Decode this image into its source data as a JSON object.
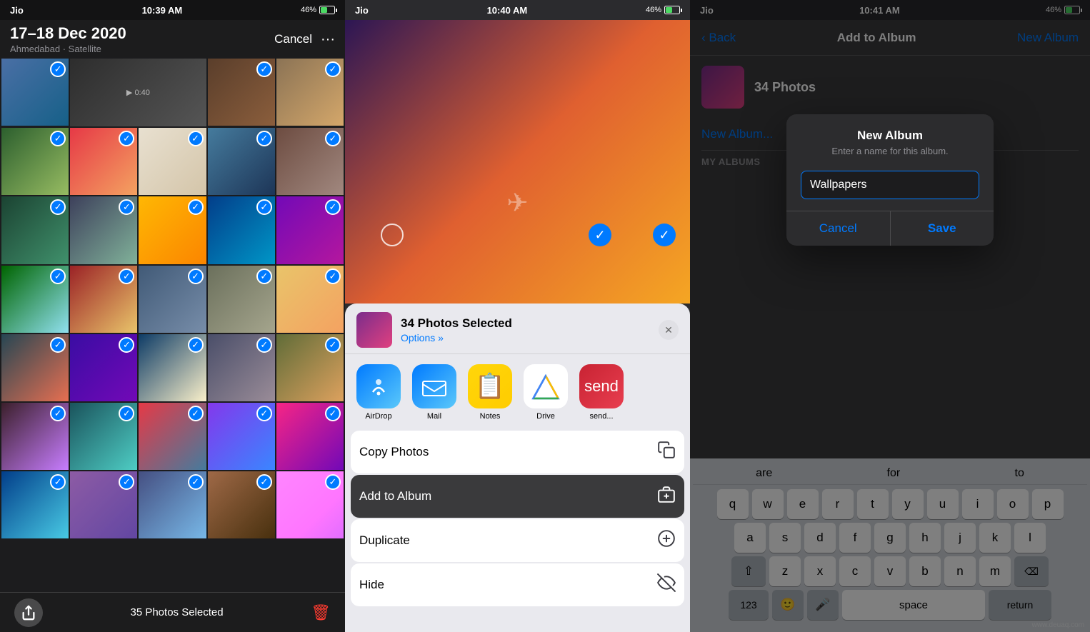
{
  "panel1": {
    "statusBar": {
      "carrier": "Jio",
      "time": "10:39 AM",
      "battery": "46%"
    },
    "header": {
      "title": "17–18 Dec 2020",
      "subtitle": "Ahmedabad · Satellite",
      "duration": "0:40",
      "cancelBtn": "Cancel",
      "moreBtn": "···"
    },
    "bottomBar": {
      "count": "35 Photos Selected"
    },
    "photoColors": [
      "c1",
      "c2",
      "c3",
      "c4",
      "c5",
      "c6",
      "c7",
      "c8",
      "c9",
      "c10",
      "c11",
      "c12",
      "c13",
      "c14",
      "c15",
      "c16",
      "c17",
      "c18",
      "c19",
      "c20",
      "c21",
      "c22",
      "c23",
      "c24",
      "c25",
      "c26",
      "c27",
      "c28",
      "c29",
      "c30"
    ]
  },
  "panel2": {
    "statusBar": {
      "carrier": "Jio",
      "time": "10:40 AM",
      "battery": "46%"
    },
    "shareSheet": {
      "title": "34 Photos Selected",
      "optionsLabel": "Options »",
      "apps": [
        {
          "name": "AirdropApp",
          "label": "AirDrop",
          "emoji": "📡"
        },
        {
          "name": "MailApp",
          "label": "Mail",
          "emoji": "✉️"
        },
        {
          "name": "NotesApp",
          "label": "Notes",
          "emoji": "📋"
        },
        {
          "name": "DriveApp",
          "label": "Drive",
          "emoji": "△"
        }
      ],
      "actions": [
        {
          "name": "CopyPhotos",
          "label": "Copy Photos",
          "icon": "⧉",
          "highlighted": false
        },
        {
          "name": "AddToAlbum",
          "label": "Add to Album",
          "icon": "🗂",
          "highlighted": true
        },
        {
          "name": "Duplicate",
          "label": "Duplicate",
          "icon": "⊕",
          "highlighted": false
        },
        {
          "name": "Hide",
          "label": "Hide",
          "icon": "👁",
          "highlighted": false
        }
      ]
    }
  },
  "panel3": {
    "statusBar": {
      "carrier": "Jio",
      "time": "10:41 AM",
      "battery": "46%"
    },
    "nav": {
      "backLabel": "‹ Back",
      "title": "Add to Album",
      "newAlbumLabel": "New Album"
    },
    "photoCount": "34 Photos",
    "newAlbumItem": "New Album...",
    "myAlbumsHeader": "My Albums",
    "dialog": {
      "title": "New Album",
      "subtitle": "Enter a name for this album.",
      "inputValue": "Wallpapers",
      "cancelBtn": "Cancel",
      "saveBtn": "Save"
    },
    "keyboard": {
      "suggestions": [
        "are",
        "for",
        "to"
      ],
      "row1": [
        "q",
        "w",
        "e",
        "r",
        "t",
        "y",
        "u",
        "i",
        "o",
        "p"
      ],
      "row2": [
        "a",
        "s",
        "d",
        "f",
        "g",
        "h",
        "j",
        "k",
        "l"
      ],
      "row3": [
        "z",
        "x",
        "c",
        "v",
        "b",
        "n",
        "m"
      ],
      "bottomLeft": "123",
      "space": "space",
      "returnKey": "return"
    }
  },
  "watermark": "www.deuaq.com"
}
